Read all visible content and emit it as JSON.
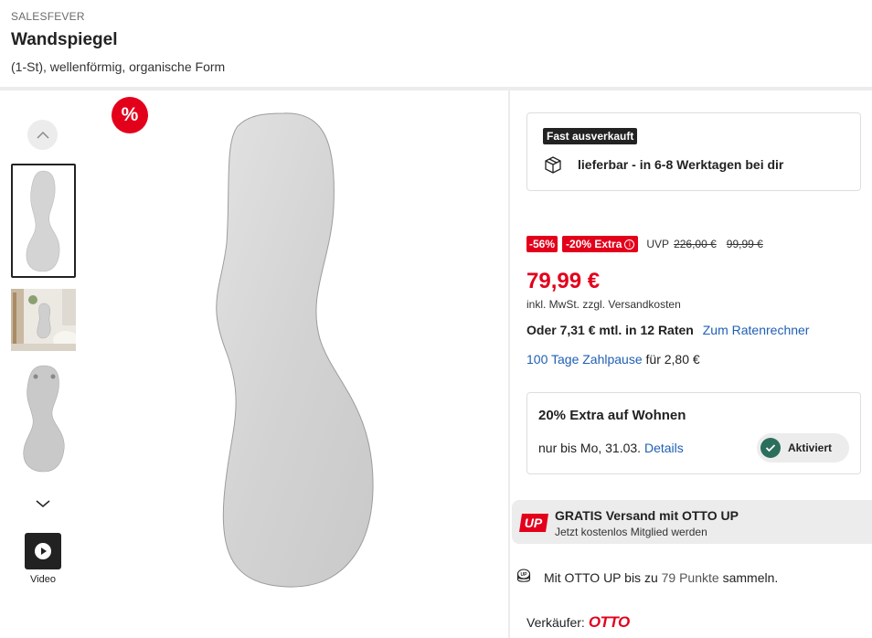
{
  "header": {
    "brand": "SALESFEVER",
    "title": "Wandspiegel",
    "subtitle": "(1-St), wellenförmig, organische Form"
  },
  "gallery": {
    "sale_badge": "%",
    "video_label": "Video"
  },
  "delivery": {
    "badge": "Fast ausverkauft",
    "text": "lieferbar - in 6-8 Werktagen bei dir"
  },
  "pricing": {
    "discount_pct": "-56%",
    "extra_pct": "-20% Extra",
    "extra_info": "i",
    "uvp_label": "UVP",
    "uvp_price": "226,00 €",
    "old_price": "99,99 €",
    "price": "79,99 €",
    "tax_prefix": "inkl. MwSt. zzgl.",
    "tax_link": "Versandkosten",
    "installment": "Oder 7,31 € mtl. in 12 Raten",
    "installment_link": "Zum Ratenrechner",
    "pause_link": "100 Tage Zahlpause",
    "pause_suffix": "für 2,80 €"
  },
  "promo": {
    "title": "20% Extra auf Wohnen",
    "date": "nur bis Mo, 31.03.",
    "details_link": "Details",
    "toggle_label": "Aktiviert"
  },
  "otto_up": {
    "logo": "UP",
    "title": "GRATIS Versand mit OTTO UP",
    "subtitle": "Jetzt kostenlos Mitglied werden"
  },
  "points": {
    "prefix": "Mit OTTO UP bis zu",
    "points": "79 Punkte",
    "suffix": "sammeln."
  },
  "seller": {
    "label": "Verkäufer:",
    "name": "OTTO"
  },
  "colors": {
    "sale_red": "#e3001b",
    "link_blue": "#1f5fb4",
    "check_green": "#2c6e5c"
  }
}
